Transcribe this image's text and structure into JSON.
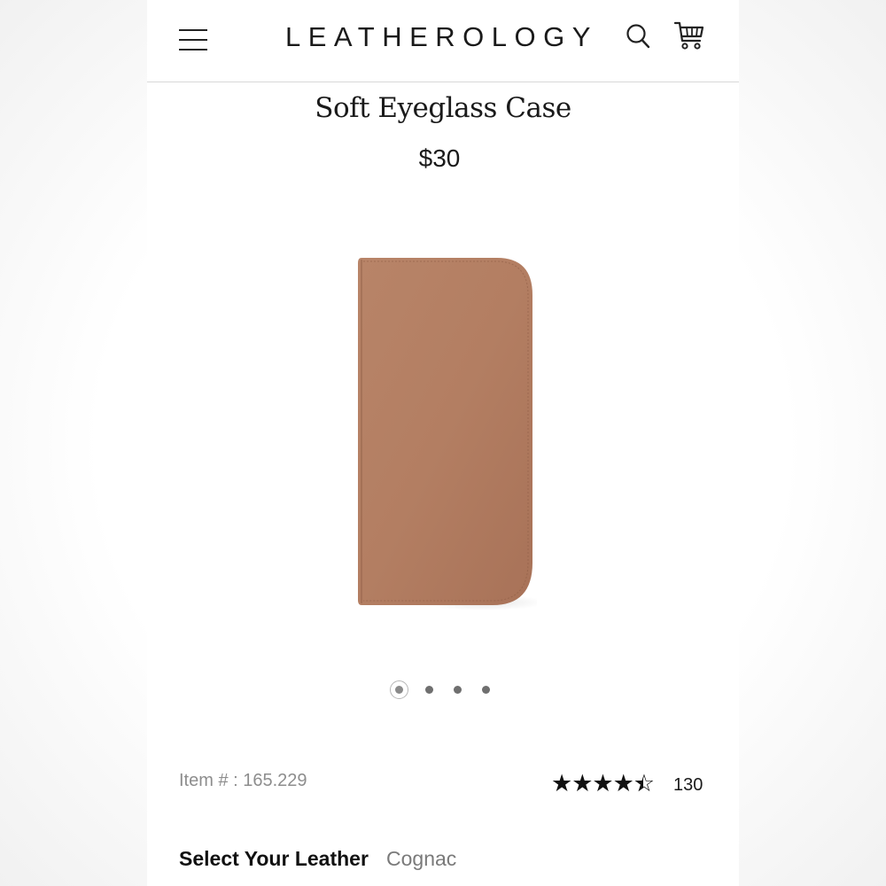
{
  "header": {
    "logo": "LEATHEROLOGY",
    "menu_icon": "hamburger-menu-icon",
    "search_icon": "search-icon",
    "cart_icon": "shopping-cart-icon"
  },
  "product": {
    "title": "Soft Eyeglass Case",
    "price": "$30",
    "image_color": "#b37e62",
    "carousel": {
      "total": 4,
      "active": 1
    },
    "item_number": "Item # : 165.229",
    "rating": {
      "stars": 4.5,
      "count": "130"
    },
    "leather": {
      "label": "Select Your Leather",
      "value": "Cognac"
    }
  }
}
